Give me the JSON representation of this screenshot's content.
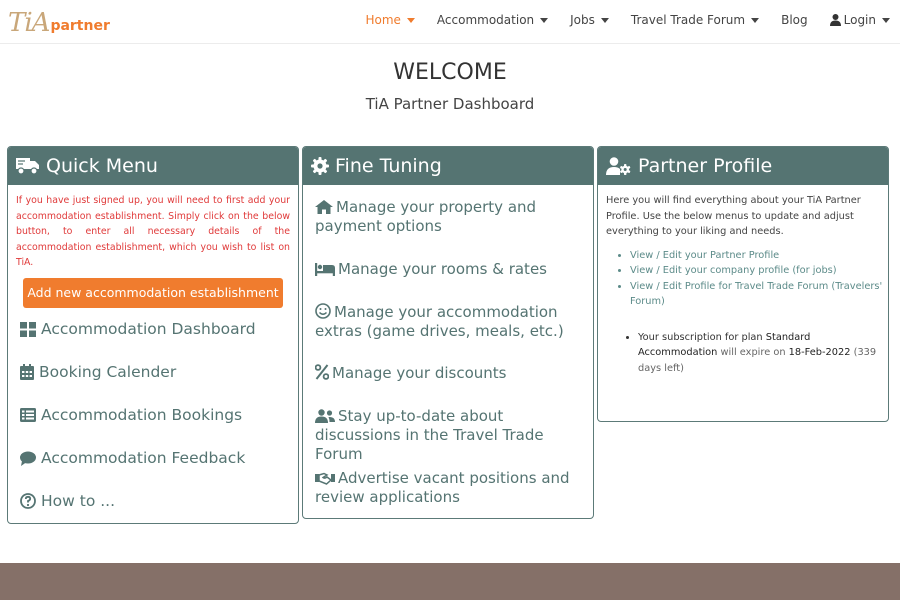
{
  "logo": {
    "main": "TiA",
    "sub": "partner"
  },
  "nav": {
    "home": "Home",
    "accommodation": "Accommodation",
    "jobs": "Jobs",
    "forum": "Travel Trade Forum",
    "blog": "Blog",
    "login": "Login"
  },
  "header": {
    "title": "WELCOME",
    "subtitle": "TiA Partner Dashboard"
  },
  "quick_menu": {
    "title": "Quick Menu",
    "notice": "If you have just signed up, you will need to first add your accommodation establishment. Simply click on the below button, to enter all necessary details of the accommodation establishment, which you wish to list on TiA.",
    "add_button": "Add new accommodation establishment",
    "links": [
      {
        "label": "Accommodation Dashboard",
        "icon": "grid-icon"
      },
      {
        "label": "Booking Calender",
        "icon": "calendar-icon"
      },
      {
        "label": "Accommodation Bookings",
        "icon": "list-icon"
      },
      {
        "label": "Accommodation Feedback",
        "icon": "comment-icon"
      },
      {
        "label": "How to ...",
        "icon": "question-icon"
      }
    ]
  },
  "fine_tuning": {
    "title": "Fine Tuning",
    "items": [
      {
        "label": "Manage your property and payment options",
        "icon": "home-icon"
      },
      {
        "label": "Manage your rooms & rates",
        "icon": "bed-icon"
      },
      {
        "label": "Manage your accommodation extras (game drives, meals, etc.)",
        "icon": "smile-icon"
      },
      {
        "label": "Manage your discounts",
        "icon": "percent-icon"
      },
      {
        "label": "Stay up-to-date about discussions in the Travel Trade Forum",
        "icon": "users-icon"
      },
      {
        "label": "Advertise vacant positions and review applications",
        "icon": "handshake-icon"
      }
    ]
  },
  "partner_profile": {
    "title": "Partner Profile",
    "intro": "Here you will find everything about your TiA Partner Profile. Use the below menus to update and adjust everything to your liking and needs.",
    "links": [
      "View / Edit your Partner Profile",
      "View / Edit your company profile (for jobs)",
      "View / Edit Profile for Travel Trade Forum (Travelers' Forum)"
    ],
    "subscription": {
      "prefix": "Your subscription for plan",
      "plan": "Standard Accommodation",
      "middle": "will expire on",
      "date": "18-Feb-2022",
      "days_left": "(339 days left)"
    }
  },
  "colors": {
    "accent": "#f07c2e",
    "header_bg": "#557472",
    "footer": "#857068",
    "warning": "#e03a3a"
  }
}
